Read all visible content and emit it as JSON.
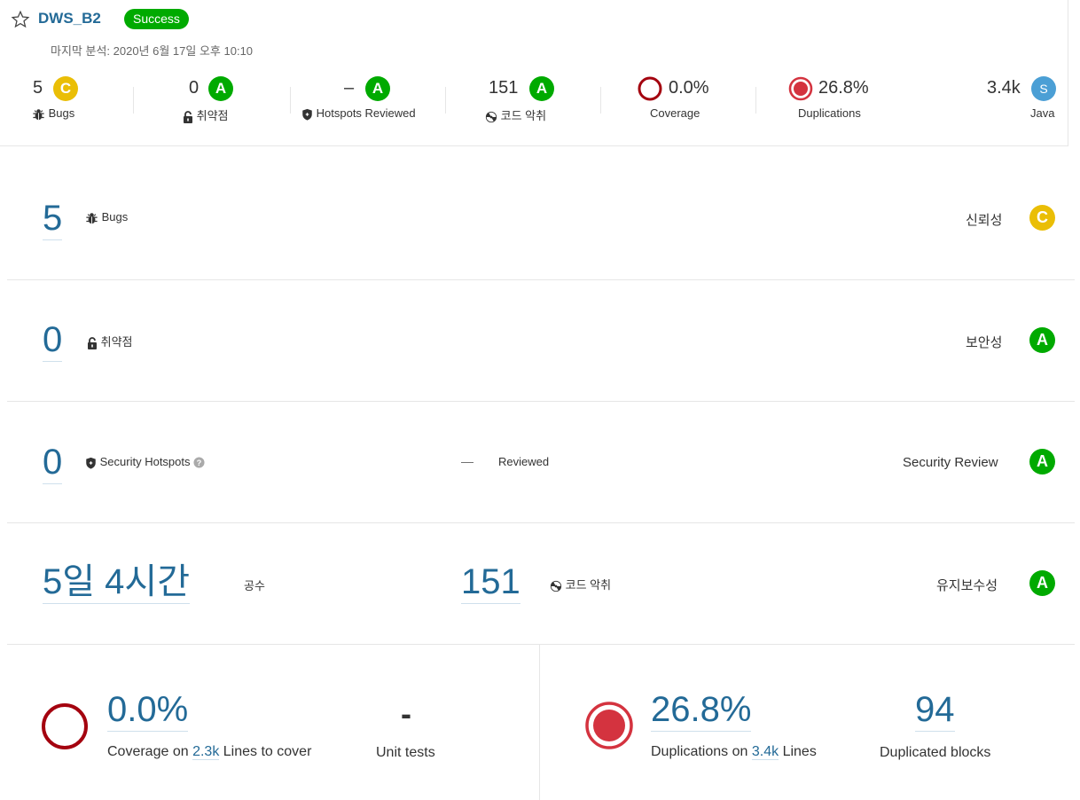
{
  "project": {
    "name": "DWS_B2",
    "status": "Success",
    "last_analysis": "마지막 분석: 2020년 6월 17일 오후 10:10"
  },
  "summary": {
    "bugs": {
      "value": "5",
      "rating": "C",
      "label": "Bugs"
    },
    "vulnerabilities": {
      "value": "0",
      "rating": "A",
      "label": "취약점"
    },
    "hotspots": {
      "value": "–",
      "rating": "A",
      "label": "Hotspots Reviewed"
    },
    "code_smells": {
      "value": "151",
      "rating": "A",
      "label": "코드 악취"
    },
    "coverage": {
      "value": "0.0%",
      "label": "Coverage"
    },
    "duplications": {
      "value": "26.8%",
      "label": "Duplications"
    },
    "size": {
      "value": "3.4k",
      "badge": "S",
      "label": "Java"
    }
  },
  "reliability": {
    "value": "5",
    "label": "Bugs",
    "rating_label": "신뢰성",
    "rating": "C"
  },
  "security": {
    "value": "0",
    "label": "취약점",
    "rating_label": "보안성",
    "rating": "A"
  },
  "security_review": {
    "value": "0",
    "label": "Security Hotspots",
    "reviewed_value": "—",
    "reviewed_label": "Reviewed",
    "rating_label": "Security Review",
    "rating": "A"
  },
  "maintainability": {
    "debt": "5일 4시간",
    "debt_label": "공수",
    "smells": "151",
    "smells_label": "코드 악취",
    "rating_label": "유지보수성",
    "rating": "A"
  },
  "coverage_section": {
    "value": "0.0%",
    "prefix": "Coverage on",
    "lines": "2.3k",
    "suffix": "Lines to cover",
    "unit_tests_value": "-",
    "unit_tests_label": "Unit tests"
  },
  "duplications_section": {
    "value": "26.8%",
    "prefix": "Duplications on",
    "lines": "3.4k",
    "suffix": "Lines",
    "blocks_value": "94",
    "blocks_label": "Duplicated blocks"
  },
  "colors": {
    "link": "#236a97",
    "rating_a": "#00aa00",
    "rating_c": "#eabe06",
    "coverage_ring": "#a4030f",
    "duplication_red": "#d4333f"
  }
}
